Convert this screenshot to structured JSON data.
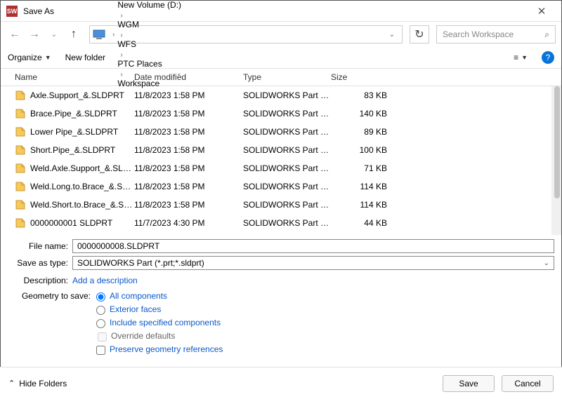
{
  "window": {
    "title": "Save As"
  },
  "path": {
    "crumbs": [
      "This PC",
      "New Volume (D:)",
      "WGM",
      "WFS",
      "PTC Places",
      "Workspace"
    ]
  },
  "search": {
    "placeholder": "Search Workspace"
  },
  "toolbar": {
    "organize": "Organize",
    "newfolder": "New folder"
  },
  "columns": {
    "name": "Name",
    "date": "Date modified",
    "type": "Type",
    "size": "Size"
  },
  "files": [
    {
      "name": "Axle.Support_&.SLDPRT",
      "date": "11/8/2023 1:58 PM",
      "type": "SOLIDWORKS Part Docu...",
      "size": "83 KB"
    },
    {
      "name": "Brace.Pipe_&.SLDPRT",
      "date": "11/8/2023 1:58 PM",
      "type": "SOLIDWORKS Part Docu...",
      "size": "140 KB"
    },
    {
      "name": "Lower Pipe_&.SLDPRT",
      "date": "11/8/2023 1:58 PM",
      "type": "SOLIDWORKS Part Docu...",
      "size": "89 KB"
    },
    {
      "name": "Short.Pipe_&.SLDPRT",
      "date": "11/8/2023 1:58 PM",
      "type": "SOLIDWORKS Part Docu...",
      "size": "100 KB"
    },
    {
      "name": "Weld.Axle.Support_&.SLDPRT",
      "date": "11/8/2023 1:58 PM",
      "type": "SOLIDWORKS Part Docu...",
      "size": "71 KB"
    },
    {
      "name": "Weld.Long.to.Brace_&.SLDPRT",
      "date": "11/8/2023 1:58 PM",
      "type": "SOLIDWORKS Part Docu...",
      "size": "114 KB"
    },
    {
      "name": "Weld.Short.to.Brace_&.SLDPRT",
      "date": "11/8/2023 1:58 PM",
      "type": "SOLIDWORKS Part Docu...",
      "size": "114 KB"
    },
    {
      "name": "0000000001 SLDPRT",
      "date": "11/7/2023 4:30 PM",
      "type": "SOLIDWORKS Part Docu",
      "size": "44 KB"
    }
  ],
  "form": {
    "filename_label": "File name:",
    "filename_value": "0000000008.SLDPRT",
    "saveas_label": "Save as type:",
    "saveas_value": "SOLIDWORKS Part (*.prt;*.sldprt)",
    "description_label": "Description:",
    "description_link": "Add a description",
    "geometry_label": "Geometry to save:",
    "opt_all": "All components",
    "opt_ext": "Exterior faces",
    "opt_inc": "Include specified components",
    "opt_ovr": "Override defaults",
    "opt_pre": "Preserve geometry references"
  },
  "footer": {
    "hide": "Hide Folders",
    "save": "Save",
    "cancel": "Cancel"
  }
}
